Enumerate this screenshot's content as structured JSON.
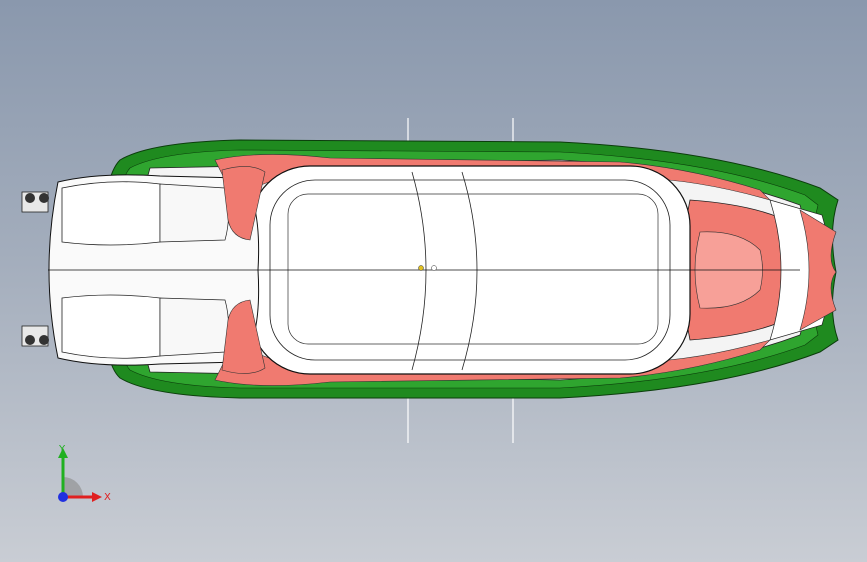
{
  "viewport": {
    "background_top": "#8a98ad",
    "background_bottom": "#c9cdd4"
  },
  "model": {
    "subject": "boat-hull-top-view",
    "hull_color": "#1f8a1f",
    "deck_color": "#ffffff",
    "accent_color": "#f07a70",
    "outline_color": "#000000"
  },
  "triad": {
    "x_label": "X",
    "y_label": "Y",
    "x_color": "#e02020",
    "y_color": "#20b020",
    "z_color": "#2030e0"
  }
}
